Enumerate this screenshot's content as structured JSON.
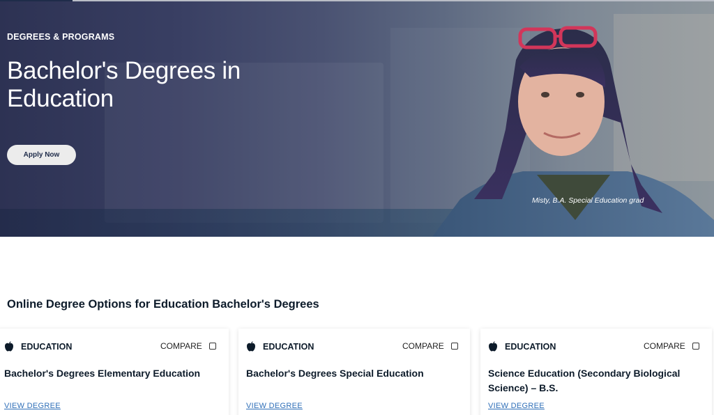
{
  "hero": {
    "kicker": "DEGREES & PROGRAMS",
    "title": "Bachelor's Degrees in Education",
    "apply_label": "Apply Now",
    "caption": "Misty, B.A. Special Education grad"
  },
  "section": {
    "heading": "Online Degree Options for Education Bachelor's Degrees"
  },
  "cards": [
    {
      "category": "EDUCATION",
      "compare": "COMPARE",
      "title": "Bachelor's Degrees Elementary Education",
      "link": "VIEW DEGREE",
      "icon": "apple-icon"
    },
    {
      "category": "EDUCATION",
      "compare": "COMPARE",
      "title": "Bachelor's Degrees Special Education",
      "link": "VIEW DEGREE",
      "icon": "apple-icon"
    },
    {
      "category": "EDUCATION",
      "compare": "COMPARE",
      "title": "Science Education (Secondary Biological Science) – B.S.",
      "link": "VIEW DEGREE",
      "icon": "apple-icon"
    }
  ],
  "colors": {
    "navy": "#0d1b2a",
    "link": "#2f6fb8",
    "hero_dark": "#2d3253"
  }
}
